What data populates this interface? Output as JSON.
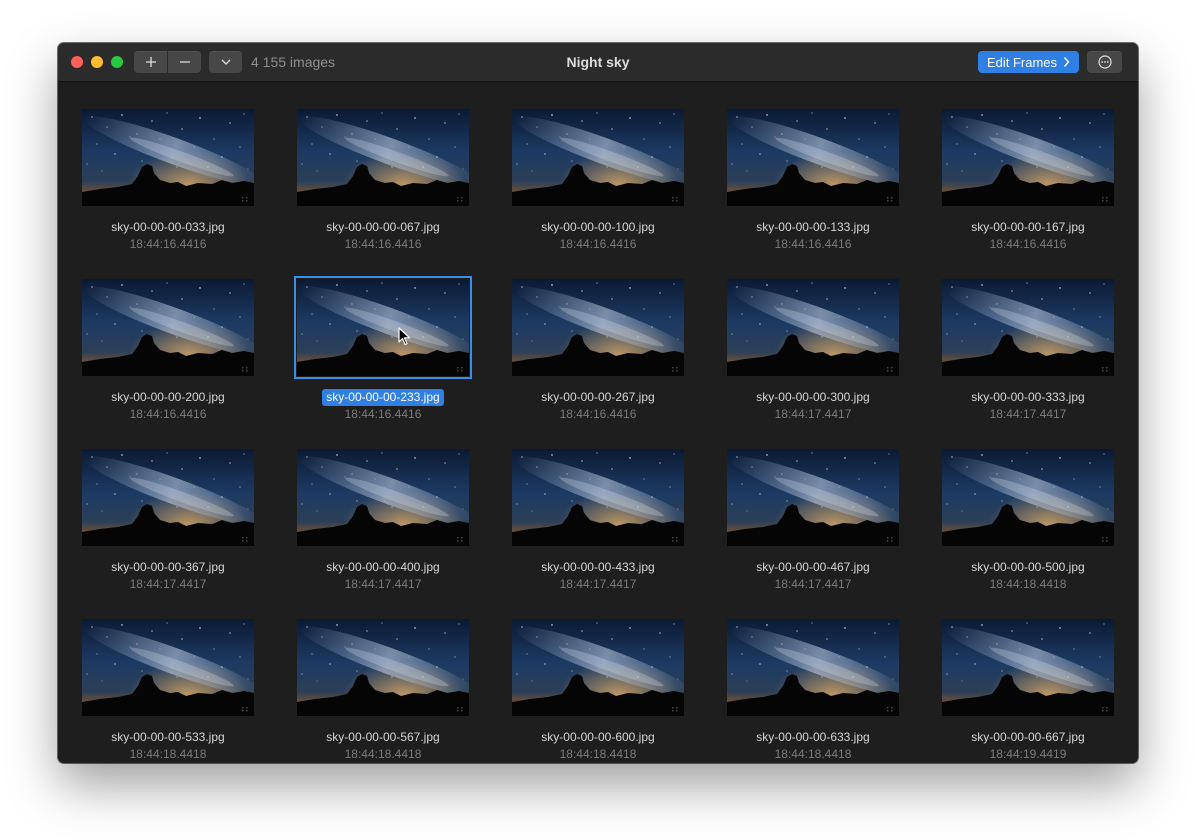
{
  "window": {
    "title": "Night sky",
    "image_count": "4 155 images",
    "edit_button_label": "Edit Frames"
  },
  "icons": {
    "add": "plus-icon",
    "remove": "minus-icon",
    "dropdown": "chevron-down-icon",
    "edit_chevron": "chevron-right-icon",
    "more": "ellipsis-circle-icon"
  },
  "colors": {
    "accent": "#2f7fe4",
    "window_bg": "#1e1e1e",
    "titlebar_bg": "#2b2b2b",
    "close": "#fe5f57",
    "minimize": "#febc2e",
    "maximize": "#28c840"
  },
  "images": [
    {
      "name": "sky-00-00-00-033.jpg",
      "time": "18:44:16.4416",
      "selected": false
    },
    {
      "name": "sky-00-00-00-067.jpg",
      "time": "18:44:16.4416",
      "selected": false
    },
    {
      "name": "sky-00-00-00-100.jpg",
      "time": "18:44:16.4416",
      "selected": false
    },
    {
      "name": "sky-00-00-00-133.jpg",
      "time": "18:44:16.4416",
      "selected": false
    },
    {
      "name": "sky-00-00-00-167.jpg",
      "time": "18:44:16.4416",
      "selected": false
    },
    {
      "name": "sky-00-00-00-200.jpg",
      "time": "18:44:16.4416",
      "selected": false
    },
    {
      "name": "sky-00-00-00-233.jpg",
      "time": "18:44:16.4416",
      "selected": true
    },
    {
      "name": "sky-00-00-00-267.jpg",
      "time": "18:44:16.4416",
      "selected": false
    },
    {
      "name": "sky-00-00-00-300.jpg",
      "time": "18:44:17.4417",
      "selected": false
    },
    {
      "name": "sky-00-00-00-333.jpg",
      "time": "18:44:17.4417",
      "selected": false
    },
    {
      "name": "sky-00-00-00-367.jpg",
      "time": "18:44:17.4417",
      "selected": false
    },
    {
      "name": "sky-00-00-00-400.jpg",
      "time": "18:44:17.4417",
      "selected": false
    },
    {
      "name": "sky-00-00-00-433.jpg",
      "time": "18:44:17.4417",
      "selected": false
    },
    {
      "name": "sky-00-00-00-467.jpg",
      "time": "18:44:17.4417",
      "selected": false
    },
    {
      "name": "sky-00-00-00-500.jpg",
      "time": "18:44:18.4418",
      "selected": false
    },
    {
      "name": "sky-00-00-00-533.jpg",
      "time": "18:44:18.4418",
      "selected": false
    },
    {
      "name": "sky-00-00-00-567.jpg",
      "time": "18:44:18.4418",
      "selected": false
    },
    {
      "name": "sky-00-00-00-600.jpg",
      "time": "18:44:18.4418",
      "selected": false
    },
    {
      "name": "sky-00-00-00-633.jpg",
      "time": "18:44:18.4418",
      "selected": false
    },
    {
      "name": "sky-00-00-00-667.jpg",
      "time": "18:44:19.4419",
      "selected": false
    }
  ]
}
